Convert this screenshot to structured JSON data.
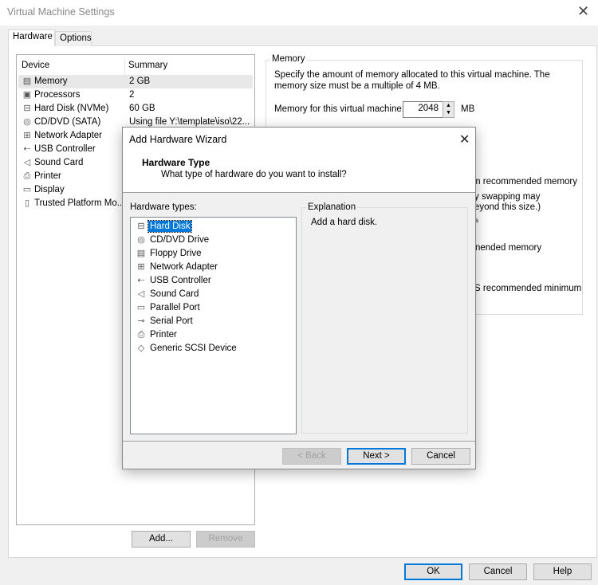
{
  "window": {
    "title": "Virtual Machine Settings",
    "close_icon": "close-icon"
  },
  "tabs": [
    {
      "label": "Hardware",
      "selected": true
    },
    {
      "label": "Options",
      "selected": false
    }
  ],
  "devices": {
    "headers": {
      "device": "Device",
      "summary": "Summary"
    },
    "rows": [
      {
        "icon": "memory-icon",
        "glyph": "▤",
        "name": "Memory",
        "summary": "2 GB",
        "selected": true
      },
      {
        "icon": "processor-icon",
        "glyph": "▣",
        "name": "Processors",
        "summary": "2"
      },
      {
        "icon": "hard-disk-icon",
        "glyph": "⊟",
        "name": "Hard Disk (NVMe)",
        "summary": "60 GB"
      },
      {
        "icon": "cd-dvd-icon",
        "glyph": "◎",
        "name": "CD/DVD (SATA)",
        "summary": "Using file Y:\\template\\iso\\22..."
      },
      {
        "icon": "network-adapter-icon",
        "glyph": "⊞",
        "name": "Network Adapter",
        "summary": ""
      },
      {
        "icon": "usb-icon",
        "glyph": "⇠",
        "name": "USB Controller",
        "summary": ""
      },
      {
        "icon": "sound-card-icon",
        "glyph": "◁",
        "name": "Sound Card",
        "summary": ""
      },
      {
        "icon": "printer-icon",
        "glyph": "⎙",
        "name": "Printer",
        "summary": ""
      },
      {
        "icon": "display-icon",
        "glyph": "▭",
        "name": "Display",
        "summary": ""
      },
      {
        "icon": "tpm-icon",
        "glyph": "▯",
        "name": "Trusted Platform Mo...",
        "summary": ""
      }
    ],
    "add_label": "Add...",
    "remove_label": "Remove"
  },
  "memory": {
    "group_label": "Memory",
    "description": "Specify the amount of memory allocated to this virtual machine. The memory size must be a multiple of 4 MB.",
    "field_label": "Memory for this virtual machine:",
    "value": "2048",
    "unit": "MB",
    "fragments": [
      "m recommended memory",
      "y swapping may",
      "eyond this size.)",
      "s",
      "nended memory",
      "S recommended minimum"
    ]
  },
  "wizard": {
    "title": "Add Hardware Wizard",
    "heading": "Hardware Type",
    "subheading": "What type of hardware do you want to install?",
    "list_label": "Hardware types:",
    "items": [
      {
        "icon": "hard-disk-icon",
        "glyph": "⊟",
        "label": "Hard Disk",
        "selected": true
      },
      {
        "icon": "cd-dvd-icon",
        "glyph": "◎",
        "label": "CD/DVD Drive"
      },
      {
        "icon": "floppy-icon",
        "glyph": "▤",
        "label": "Floppy Drive"
      },
      {
        "icon": "network-adapter-icon",
        "glyph": "⊞",
        "label": "Network Adapter"
      },
      {
        "icon": "usb-icon",
        "glyph": "⇠",
        "label": "USB Controller"
      },
      {
        "icon": "sound-card-icon",
        "glyph": "◁",
        "label": "Sound Card"
      },
      {
        "icon": "parallel-port-icon",
        "glyph": "▭",
        "label": "Parallel Port"
      },
      {
        "icon": "serial-port-icon",
        "glyph": "⊸",
        "label": "Serial Port"
      },
      {
        "icon": "printer-icon",
        "glyph": "⎙",
        "label": "Printer"
      },
      {
        "icon": "scsi-icon",
        "glyph": "◇",
        "label": "Generic SCSI Device"
      }
    ],
    "explanation_label": "Explanation",
    "explanation": "Add a hard disk.",
    "back": "< Back",
    "next": "Next >",
    "cancel": "Cancel"
  },
  "footer": {
    "ok": "OK",
    "cancel": "Cancel",
    "help": "Help"
  },
  "colors": {
    "accent": "#0078d7"
  }
}
